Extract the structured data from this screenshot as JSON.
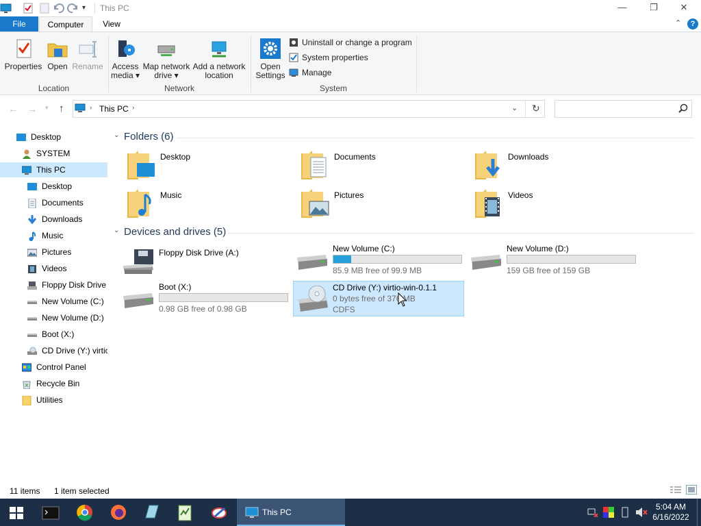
{
  "window": {
    "title": "This PC"
  },
  "tabs": {
    "file": "File",
    "computer": "Computer",
    "view": "View"
  },
  "ribbon": {
    "properties": "Properties",
    "open": "Open",
    "rename": "Rename",
    "access_media_1": "Access",
    "access_media_2": "media ▾",
    "map_drive_1": "Map network",
    "map_drive_2": "drive ▾",
    "add_location_1": "Add a network",
    "add_location_2": "location",
    "open_settings_1": "Open",
    "open_settings_2": "Settings",
    "uninstall": "Uninstall or change a program",
    "system_properties": "System properties",
    "manage": "Manage",
    "group_location": "Location",
    "group_network": "Network",
    "group_system": "System"
  },
  "address": {
    "crumb": "This PC",
    "search_placeholder": ""
  },
  "nav": {
    "desktop_root": "Desktop",
    "system": "SYSTEM",
    "this_pc": "This PC",
    "desktop": "Desktop",
    "documents": "Documents",
    "downloads": "Downloads",
    "music": "Music",
    "pictures": "Pictures",
    "videos": "Videos",
    "floppy": "Floppy Disk Drive",
    "new_c": "New Volume (C:)",
    "new_d": "New Volume (D:)",
    "boot": "Boot (X:)",
    "cd": "CD Drive (Y:) virtic",
    "control_panel": "Control Panel",
    "recycle_bin": "Recycle Bin",
    "utilities": "Utilities"
  },
  "folders": {
    "header": "Folders (6)",
    "desktop": "Desktop",
    "documents": "Documents",
    "downloads": "Downloads",
    "music": "Music",
    "pictures": "Pictures",
    "videos": "Videos"
  },
  "drives": {
    "header": "Devices and drives (5)",
    "floppy": {
      "name": "Floppy Disk Drive (A:)"
    },
    "c": {
      "name": "New Volume (C:)",
      "free": "85.9 MB free of 99.9 MB",
      "used_fraction": 0.14
    },
    "d": {
      "name": "New Volume (D:)",
      "free": "159 GB free of 159 GB",
      "used_fraction": 0.0
    },
    "boot": {
      "name": "Boot (X:)",
      "free": "0.98 GB free of 0.98 GB",
      "used_fraction": 0.0
    },
    "cd": {
      "name": "CD Drive (Y:) virtio-win-0.1.1",
      "free": "0 bytes free of 376 MB",
      "fs": "CDFS"
    }
  },
  "status": {
    "items": "11 items",
    "selected": "1 item selected"
  },
  "taskbar": {
    "active_label": "This PC",
    "time": "5:04 AM",
    "date": "6/16/2022"
  },
  "colors": {
    "accent": "#1979ca",
    "selection": "#cce8ff",
    "taskbar": "#1c2f47",
    "progress": "#26a0da"
  }
}
